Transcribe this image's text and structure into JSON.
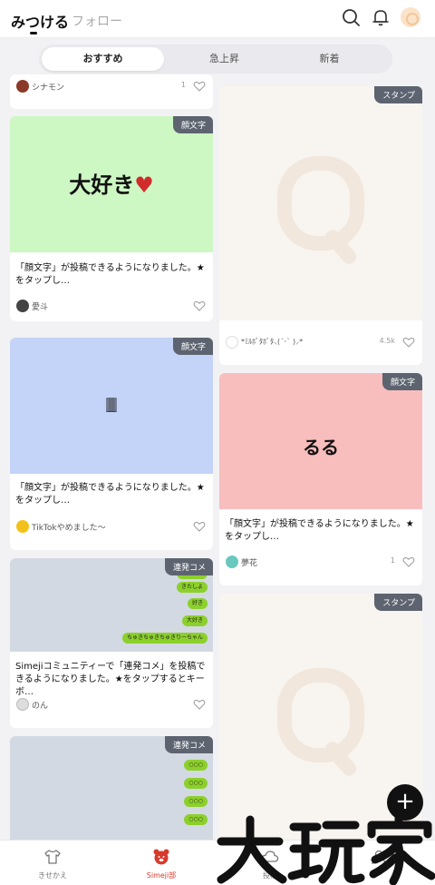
{
  "header": {
    "tab_discover": "みつける",
    "tab_follow": "フォロー",
    "icons": [
      "search-icon",
      "bell-icon",
      "avatar"
    ]
  },
  "segments": [
    "おすすめ",
    "急上昇",
    "新着"
  ],
  "cards": {
    "top_partial": {
      "user": "シナモン",
      "count": "1"
    },
    "kao1": {
      "badge": "顔文字",
      "art": "大好き",
      "art_heart": "♥",
      "desc": "「顔文字」が投稿できるようになりました。★をタップし…",
      "user": "愛斗"
    },
    "kao2": {
      "badge": "顔文字",
      "art": "🀫",
      "desc": "「顔文字」が投稿できるようになりました。★をタップし…",
      "user": "TikTokやめました〜"
    },
    "renpatsu1": {
      "badge": "連発コメ",
      "bubbles": [
        "愛してる",
        "きたしよ",
        "好き",
        "大好き",
        "ちゅきちゅきちゅきりーちゃん"
      ],
      "desc": "Simejiコミュニティーで「連発コメ」を投稿できるようになりました。★をタップするとキーボ…",
      "user": "のん"
    },
    "renpatsu2": {
      "badge": "連発コメ",
      "bubbles": [
        "○○○",
        "○○○",
        "○○○",
        "○○○"
      ]
    },
    "stamp1": {
      "badge": "スタンプ",
      "user": "*ﾐﾙﾎﾞﾀﾎﾞﾀ⸜(ˊᵕˋ )⸝*",
      "count": "4.5k"
    },
    "kao3": {
      "badge": "顔文字",
      "art": "るる",
      "desc": "「顔文字」が投稿できるようになりました。★をタップし…",
      "user": "夢花",
      "count": "1"
    },
    "stamp2": {
      "badge": "スタンプ"
    }
  },
  "bottom_nav": [
    {
      "label": "きせかえ",
      "icon": "shirt-icon"
    },
    {
      "label": "Simeji部",
      "icon": "bear-icon"
    },
    {
      "label": "投稿",
      "icon": "cloud-icon"
    },
    {
      "label": "",
      "icon": "profile-icon"
    }
  ],
  "fab": {
    "label": "+"
  },
  "watermark": "大玩家",
  "colors": {
    "accent": "#d83a2c",
    "badge": "#5d6470",
    "kao1_bg": "#cdf7c3",
    "kao2_bg": "#c4d4f8",
    "kao3_bg": "#f8bdbd",
    "stamp_bg": "#f8f4ef",
    "renpatsu_bg": "#d3d9e2"
  }
}
